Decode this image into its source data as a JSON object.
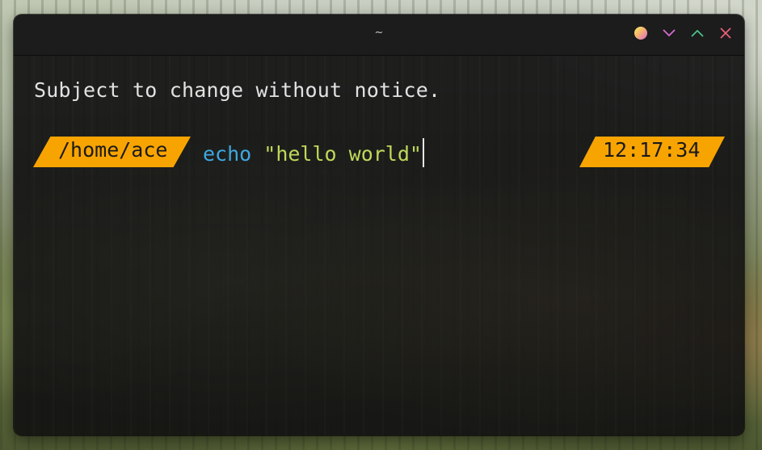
{
  "window": {
    "title": "~"
  },
  "controls": [
    {
      "name": "theme-toggle",
      "icon": "theme-gradient-dot-icon",
      "color": "#f4c96a"
    },
    {
      "name": "minimize",
      "icon": "chevron-down-icon",
      "color": "#d86ad6"
    },
    {
      "name": "maximize",
      "icon": "chevron-up-icon",
      "color": "#4cc38a"
    },
    {
      "name": "close",
      "icon": "close-icon",
      "color": "#e8607a"
    }
  ],
  "terminal": {
    "motd": "Subject to change without notice.",
    "prompt_path": "/home/ace",
    "command": "echo",
    "argument": "\"hello world\"",
    "clock": "12:17:34"
  },
  "colors": {
    "accent": "#f8a400",
    "command": "#3fa7e0",
    "string": "#bfd85a",
    "text": "#e2e2e2"
  }
}
